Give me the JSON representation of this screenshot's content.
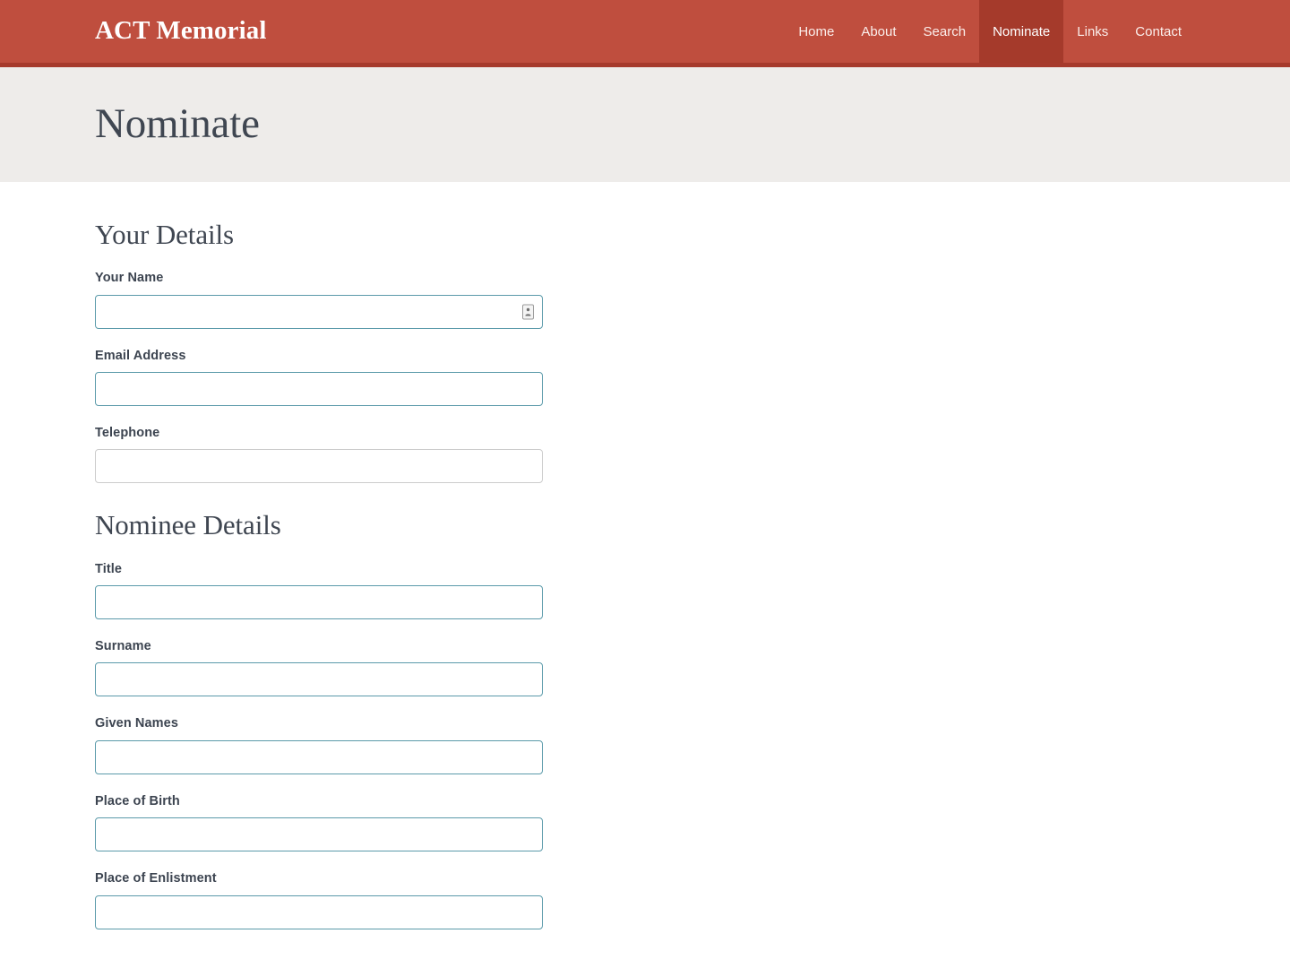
{
  "header": {
    "brand": "ACT Memorial",
    "nav": [
      {
        "label": "Home",
        "active": false
      },
      {
        "label": "About",
        "active": false
      },
      {
        "label": "Search",
        "active": false
      },
      {
        "label": "Nominate",
        "active": true
      },
      {
        "label": "Links",
        "active": false
      },
      {
        "label": "Contact",
        "active": false
      }
    ]
  },
  "hero": {
    "title": "Nominate"
  },
  "form": {
    "sections": [
      {
        "heading": "Your Details",
        "fields": [
          {
            "label": "Your Name",
            "value": "",
            "placeholder": "",
            "style": "accent",
            "icon": "contact-card-icon"
          },
          {
            "label": "Email Address",
            "value": "",
            "placeholder": "",
            "style": "accent",
            "icon": ""
          },
          {
            "label": "Telephone",
            "value": "",
            "placeholder": "",
            "style": "plain",
            "icon": ""
          }
        ]
      },
      {
        "heading": "Nominee Details",
        "fields": [
          {
            "label": "Title",
            "value": "",
            "placeholder": "",
            "style": "accent",
            "icon": ""
          },
          {
            "label": "Surname",
            "value": "",
            "placeholder": "",
            "style": "accent",
            "icon": ""
          },
          {
            "label": "Given Names",
            "value": "",
            "placeholder": "",
            "style": "accent",
            "icon": ""
          },
          {
            "label": "Place of Birth",
            "value": "",
            "placeholder": "",
            "style": "accent",
            "icon": ""
          },
          {
            "label": "Place of Enlistment",
            "value": "",
            "placeholder": "",
            "style": "accent",
            "icon": ""
          }
        ]
      }
    ]
  },
  "colors": {
    "header_background": "#bf4e3e",
    "header_border": "#a63a2c",
    "nav_active_background": "#a53a2b",
    "hero_background": "#eeecea",
    "heading_text": "#3f4651",
    "label_text": "#3c4450",
    "field_border_accent": "#5b9aaa",
    "field_border_plain": "#cccccc",
    "page_background": "#ffffff"
  }
}
